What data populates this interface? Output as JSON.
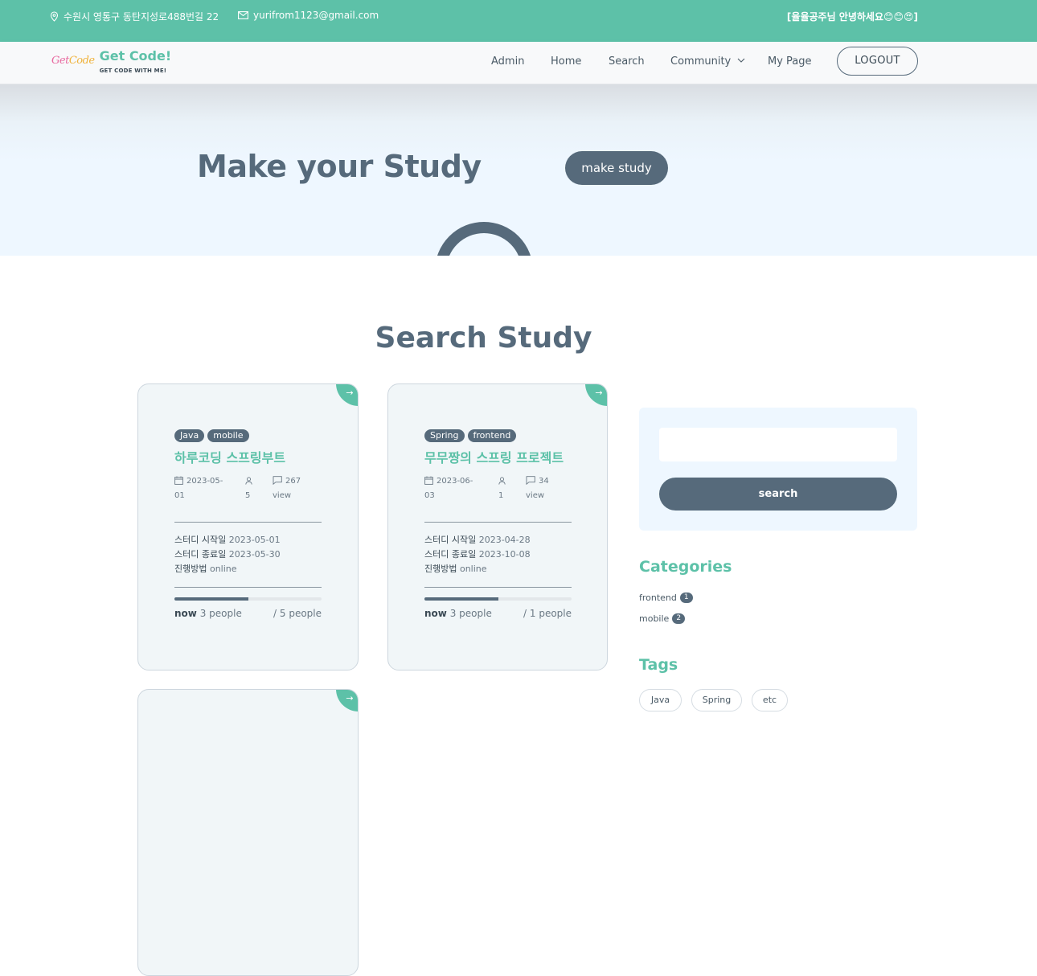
{
  "topbar": {
    "address": "수원시 영통구 동탄지성로488번길 22",
    "email": "yurifrom1123@gmail.com",
    "greeting": "[율율공주님 안녕하세요😊😊😍]",
    "icons": [
      "location-pin-icon",
      "mail-icon"
    ]
  },
  "brand": {
    "mark_get": "Get",
    "mark_code": "Code",
    "title": "Get Code!",
    "subtitle": "GET CODE WITH ME!"
  },
  "nav": {
    "items": [
      "Admin",
      "Home",
      "Search",
      "Community",
      "My Page"
    ],
    "community_icon": "chevron-down-icon",
    "logout": "LOGOUT"
  },
  "hero": {
    "title": "Make your Study",
    "button": "make study"
  },
  "main": {
    "section_title": "Search Study",
    "cards": [
      {
        "tags": [
          "Java",
          "mobile"
        ],
        "title": "하루코딩 스프링부트",
        "date": "2023-05-01",
        "members": "5",
        "views": "267",
        "views_unit": "view",
        "start_label": "스터디 시작일",
        "start": "2023-05-01",
        "end_label": "스터디 종료일",
        "end": "2023-05-30",
        "mode_label": "진행방법",
        "mode": "online",
        "progress": 0.5,
        "now_label": "now",
        "now": "3 people",
        "max": "/ 5 people"
      },
      {
        "tags": [
          "Spring",
          "frontend"
        ],
        "title": "무무짱의 스프링 프로젝트",
        "date": "2023-06-03",
        "members": "1",
        "views": "34",
        "views_unit": "view",
        "start_label": "스터디 시작일",
        "start": "2023-04-28",
        "end_label": "스터디 종료일",
        "end": "2023-10-08",
        "mode_label": "진행방법",
        "mode": "online",
        "progress": 0.5,
        "now_label": "now",
        "now": "3 people",
        "max": "/ 1 people"
      }
    ],
    "card_arrow": "→"
  },
  "sidebar": {
    "search_placeholder": "",
    "search_button": "search",
    "categories_title": "Categories",
    "categories": [
      {
        "name": "frontend",
        "count": "1"
      },
      {
        "name": "mobile",
        "count": "2"
      }
    ],
    "tags_title": "Tags",
    "tags": [
      "Java",
      "Spring",
      "etc"
    ]
  },
  "colors": {
    "accent": "#5dc1a8",
    "slate": "#566a7b",
    "hero_bg": "#eef7ff"
  }
}
